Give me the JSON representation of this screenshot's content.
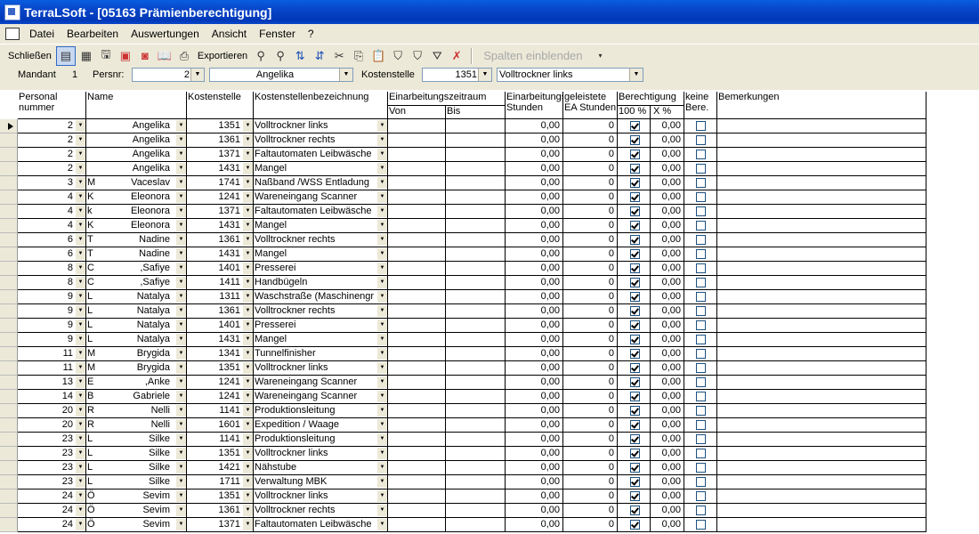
{
  "window": {
    "title": "TerraLSoft - [05163 Prämienberechtigung]"
  },
  "menu": [
    "Datei",
    "Bearbeiten",
    "Auswertungen",
    "Ansicht",
    "Fenster",
    "?"
  ],
  "toolbar": {
    "close_label": "Schließen",
    "export_label": "Exportieren",
    "show_columns_label": "Spalten einblenden"
  },
  "params": {
    "mandant_label": "Mandant",
    "mandant_value": "1",
    "persnr_label": "Persnr:",
    "persnr_value": "2",
    "name_value": "Angelika",
    "kst_label": "Kostenstelle",
    "kst_value": "1351",
    "kst_name_value": "Volltrockner links"
  },
  "headers": {
    "persnr": "Personal",
    "persnr2": "nummer",
    "name": "Name",
    "kst": "Kostenstelle",
    "kstbez": "Kostenstellenbezeichnung",
    "ezr": "Einarbeitungszeitraum",
    "von": "Von",
    "bis": "Bis",
    "ezs1": "Einarbeitungs",
    "ezs2": "Stunden",
    "ea1": "geleistete",
    "ea2": "EA Stunden",
    "ber": "Berechtigung",
    "p100": "100 %",
    "px": "X %",
    "keine1": "keine",
    "keine2": "Bere.",
    "bem": "Bemerkungen"
  },
  "rows": [
    {
      "nr": "2",
      "ini": "",
      "name": "Angelika",
      "kst": "1351",
      "bez": "Volltrockner links",
      "std": "0,00",
      "ea": "0",
      "b100": true,
      "bx": "0,00",
      "keine": false
    },
    {
      "nr": "2",
      "ini": "",
      "name": "Angelika",
      "kst": "1361",
      "bez": "Volltrockner rechts",
      "std": "0,00",
      "ea": "0",
      "b100": true,
      "bx": "0,00",
      "keine": false
    },
    {
      "nr": "2",
      "ini": "",
      "name": "Angelika",
      "kst": "1371",
      "bez": "Faltautomaten Leibwäsche",
      "std": "0,00",
      "ea": "0",
      "b100": true,
      "bx": "0,00",
      "keine": false
    },
    {
      "nr": "2",
      "ini": "",
      "name": "Angelika",
      "kst": "1431",
      "bez": "Mangel",
      "std": "0,00",
      "ea": "0",
      "b100": true,
      "bx": "0,00",
      "keine": false
    },
    {
      "nr": "3",
      "ini": "M",
      "name": "Vaceslav",
      "kst": "1741",
      "bez": "Naßband /WSS Entladung",
      "std": "0,00",
      "ea": "0",
      "b100": true,
      "bx": "0,00",
      "keine": false
    },
    {
      "nr": "4",
      "ini": "K",
      "name": "Eleonora",
      "kst": "1241",
      "bez": "Wareneingang Scanner",
      "std": "0,00",
      "ea": "0",
      "b100": true,
      "bx": "0,00",
      "keine": false
    },
    {
      "nr": "4",
      "ini": "k",
      "name": "Eleonora",
      "kst": "1371",
      "bez": "Faltautomaten Leibwäsche",
      "std": "0,00",
      "ea": "0",
      "b100": true,
      "bx": "0,00",
      "keine": false
    },
    {
      "nr": "4",
      "ini": "K",
      "name": "Eleonora",
      "kst": "1431",
      "bez": "Mangel",
      "std": "0,00",
      "ea": "0",
      "b100": true,
      "bx": "0,00",
      "keine": false
    },
    {
      "nr": "6",
      "ini": "T",
      "name": "Nadine",
      "kst": "1361",
      "bez": "Volltrockner rechts",
      "std": "0,00",
      "ea": "0",
      "b100": true,
      "bx": "0,00",
      "keine": false
    },
    {
      "nr": "6",
      "ini": "T",
      "name": "Nadine",
      "kst": "1431",
      "bez": "Mangel",
      "std": "0,00",
      "ea": "0",
      "b100": true,
      "bx": "0,00",
      "keine": false
    },
    {
      "nr": "8",
      "ini": "C",
      "name": ",Safiye",
      "kst": "1401",
      "bez": "Presserei",
      "std": "0,00",
      "ea": "0",
      "b100": true,
      "bx": "0,00",
      "keine": false
    },
    {
      "nr": "8",
      "ini": "C",
      "name": ",Safiye",
      "kst": "1411",
      "bez": "Handbügeln",
      "std": "0,00",
      "ea": "0",
      "b100": true,
      "bx": "0,00",
      "keine": false
    },
    {
      "nr": "9",
      "ini": "L",
      "name": "Natalya",
      "kst": "1311",
      "bez": "Waschstraße (Maschinengr",
      "std": "0,00",
      "ea": "0",
      "b100": true,
      "bx": "0,00",
      "keine": false
    },
    {
      "nr": "9",
      "ini": "L",
      "name": "Natalya",
      "kst": "1361",
      "bez": "Volltrockner rechts",
      "std": "0,00",
      "ea": "0",
      "b100": true,
      "bx": "0,00",
      "keine": false
    },
    {
      "nr": "9",
      "ini": "L",
      "name": "Natalya",
      "kst": "1401",
      "bez": "Presserei",
      "std": "0,00",
      "ea": "0",
      "b100": true,
      "bx": "0,00",
      "keine": false
    },
    {
      "nr": "9",
      "ini": "L",
      "name": "Natalya",
      "kst": "1431",
      "bez": "Mangel",
      "std": "0,00",
      "ea": "0",
      "b100": true,
      "bx": "0,00",
      "keine": false
    },
    {
      "nr": "11",
      "ini": "M",
      "name": "Brygida",
      "kst": "1341",
      "bez": "Tunnelfinisher",
      "std": "0,00",
      "ea": "0",
      "b100": true,
      "bx": "0,00",
      "keine": false
    },
    {
      "nr": "11",
      "ini": "M",
      "name": "Brygida",
      "kst": "1351",
      "bez": "Volltrockner links",
      "std": "0,00",
      "ea": "0",
      "b100": true,
      "bx": "0,00",
      "keine": false
    },
    {
      "nr": "13",
      "ini": "E",
      "name": ",Anke",
      "kst": "1241",
      "bez": "Wareneingang Scanner",
      "std": "0,00",
      "ea": "0",
      "b100": true,
      "bx": "0,00",
      "keine": false
    },
    {
      "nr": "14",
      "ini": "B",
      "name": "Gabriele",
      "kst": "1241",
      "bez": "Wareneingang Scanner",
      "std": "0,00",
      "ea": "0",
      "b100": true,
      "bx": "0,00",
      "keine": false
    },
    {
      "nr": "20",
      "ini": "R",
      "name": "Nelli",
      "kst": "1141",
      "bez": "Produktionsleitung",
      "std": "0,00",
      "ea": "0",
      "b100": true,
      "bx": "0,00",
      "keine": false
    },
    {
      "nr": "20",
      "ini": "R",
      "name": "Nelli",
      "kst": "1601",
      "bez": "Expedition / Waage",
      "std": "0,00",
      "ea": "0",
      "b100": true,
      "bx": "0,00",
      "keine": false
    },
    {
      "nr": "23",
      "ini": "L",
      "name": "Silke",
      "kst": "1141",
      "bez": "Produktionsleitung",
      "std": "0,00",
      "ea": "0",
      "b100": true,
      "bx": "0,00",
      "keine": false
    },
    {
      "nr": "23",
      "ini": "L",
      "name": "Silke",
      "kst": "1351",
      "bez": "Volltrockner links",
      "std": "0,00",
      "ea": "0",
      "b100": true,
      "bx": "0,00",
      "keine": false
    },
    {
      "nr": "23",
      "ini": "L",
      "name": "Silke",
      "kst": "1421",
      "bez": "Nähstube",
      "std": "0,00",
      "ea": "0",
      "b100": true,
      "bx": "0,00",
      "keine": false
    },
    {
      "nr": "23",
      "ini": "L",
      "name": "Silke",
      "kst": "1711",
      "bez": "Verwaltung MBK",
      "std": "0,00",
      "ea": "0",
      "b100": true,
      "bx": "0,00",
      "keine": false
    },
    {
      "nr": "24",
      "ini": "Ö",
      "name": "Sevim",
      "kst": "1351",
      "bez": "Volltrockner links",
      "std": "0,00",
      "ea": "0",
      "b100": true,
      "bx": "0,00",
      "keine": false
    },
    {
      "nr": "24",
      "ini": "Ö",
      "name": "Sevim",
      "kst": "1361",
      "bez": "Volltrockner rechts",
      "std": "0,00",
      "ea": "0",
      "b100": true,
      "bx": "0,00",
      "keine": false
    },
    {
      "nr": "24",
      "ini": "Ö",
      "name": "Sevim",
      "kst": "1371",
      "bez": "Faltautomaten Leibwäsche",
      "std": "0,00",
      "ea": "0",
      "b100": true,
      "bx": "0,00",
      "keine": false
    }
  ]
}
